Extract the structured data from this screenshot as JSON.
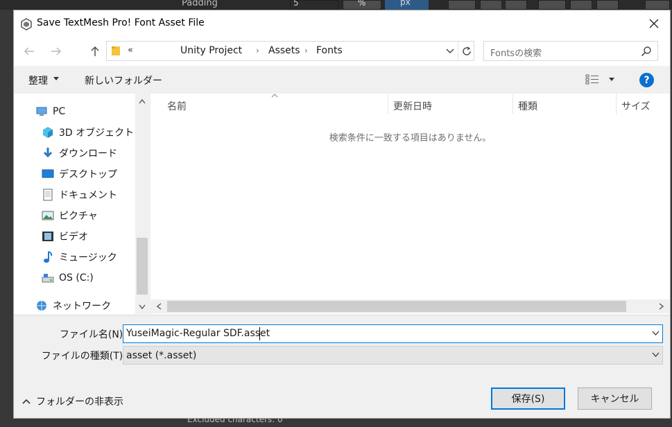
{
  "background": {
    "padding_label": "Padding",
    "padding_value": "5",
    "percent_label": "%",
    "px_label": "px",
    "excluded_text": "Excluded characters: 0"
  },
  "dialog": {
    "title": "Save TextMesh Pro! Font Asset File",
    "address": {
      "prefix": "«",
      "crumbs": [
        "Unity Project",
        "Assets",
        "Fonts"
      ],
      "separator": "›"
    },
    "search_placeholder": "Fontsの検索",
    "toolbar": {
      "organize": "整理",
      "new_folder": "新しいフォルダー"
    },
    "nav_items": [
      {
        "label": "PC",
        "icon": "pc-icon"
      },
      {
        "label": "3D オブジェクト",
        "icon": "3d-objects-icon"
      },
      {
        "label": "ダウンロード",
        "icon": "download-icon"
      },
      {
        "label": "デスクトップ",
        "icon": "desktop-icon"
      },
      {
        "label": "ドキュメント",
        "icon": "document-icon"
      },
      {
        "label": "ピクチャ",
        "icon": "pictures-icon"
      },
      {
        "label": "ビデオ",
        "icon": "video-icon"
      },
      {
        "label": "ミュージック",
        "icon": "music-icon"
      },
      {
        "label": "OS (C:)",
        "icon": "drive-icon"
      },
      {
        "label": "ネットワーク",
        "icon": "network-icon"
      }
    ],
    "columns": [
      "名前",
      "更新日時",
      "種類",
      "サイズ"
    ],
    "empty_message": "検索条件に一致する項目はありません。",
    "filename_label": "ファイル名(N):",
    "filename_value": "YuseiMagic-Regular SDF.asset",
    "filetype_label": "ファイルの種類(T):",
    "filetype_value": "asset (*.asset)",
    "hide_folders": "フォルダーの非表示",
    "save_button": "保存(S)",
    "cancel_button": "キャンセル"
  },
  "colors": {
    "accent": "#0078d7",
    "help": "#0a6fd0"
  }
}
